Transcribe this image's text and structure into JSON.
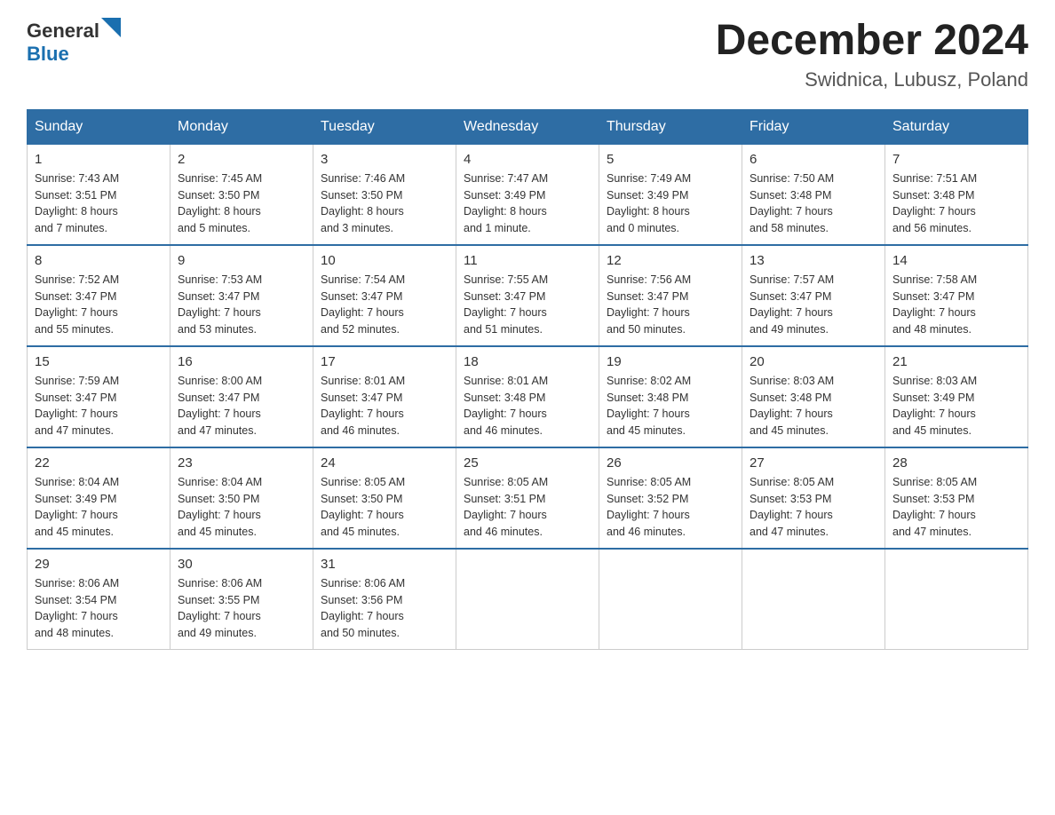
{
  "header": {
    "logo": {
      "text_general": "General",
      "text_blue": "Blue"
    },
    "month_title": "December 2024",
    "location": "Swidnica, Lubusz, Poland"
  },
  "calendar": {
    "days_of_week": [
      "Sunday",
      "Monday",
      "Tuesday",
      "Wednesday",
      "Thursday",
      "Friday",
      "Saturday"
    ],
    "weeks": [
      [
        {
          "day": "1",
          "sunrise": "Sunrise: 7:43 AM",
          "sunset": "Sunset: 3:51 PM",
          "daylight": "Daylight: 8 hours",
          "daylight2": "and 7 minutes."
        },
        {
          "day": "2",
          "sunrise": "Sunrise: 7:45 AM",
          "sunset": "Sunset: 3:50 PM",
          "daylight": "Daylight: 8 hours",
          "daylight2": "and 5 minutes."
        },
        {
          "day": "3",
          "sunrise": "Sunrise: 7:46 AM",
          "sunset": "Sunset: 3:50 PM",
          "daylight": "Daylight: 8 hours",
          "daylight2": "and 3 minutes."
        },
        {
          "day": "4",
          "sunrise": "Sunrise: 7:47 AM",
          "sunset": "Sunset: 3:49 PM",
          "daylight": "Daylight: 8 hours",
          "daylight2": "and 1 minute."
        },
        {
          "day": "5",
          "sunrise": "Sunrise: 7:49 AM",
          "sunset": "Sunset: 3:49 PM",
          "daylight": "Daylight: 8 hours",
          "daylight2": "and 0 minutes."
        },
        {
          "day": "6",
          "sunrise": "Sunrise: 7:50 AM",
          "sunset": "Sunset: 3:48 PM",
          "daylight": "Daylight: 7 hours",
          "daylight2": "and 58 minutes."
        },
        {
          "day": "7",
          "sunrise": "Sunrise: 7:51 AM",
          "sunset": "Sunset: 3:48 PM",
          "daylight": "Daylight: 7 hours",
          "daylight2": "and 56 minutes."
        }
      ],
      [
        {
          "day": "8",
          "sunrise": "Sunrise: 7:52 AM",
          "sunset": "Sunset: 3:47 PM",
          "daylight": "Daylight: 7 hours",
          "daylight2": "and 55 minutes."
        },
        {
          "day": "9",
          "sunrise": "Sunrise: 7:53 AM",
          "sunset": "Sunset: 3:47 PM",
          "daylight": "Daylight: 7 hours",
          "daylight2": "and 53 minutes."
        },
        {
          "day": "10",
          "sunrise": "Sunrise: 7:54 AM",
          "sunset": "Sunset: 3:47 PM",
          "daylight": "Daylight: 7 hours",
          "daylight2": "and 52 minutes."
        },
        {
          "day": "11",
          "sunrise": "Sunrise: 7:55 AM",
          "sunset": "Sunset: 3:47 PM",
          "daylight": "Daylight: 7 hours",
          "daylight2": "and 51 minutes."
        },
        {
          "day": "12",
          "sunrise": "Sunrise: 7:56 AM",
          "sunset": "Sunset: 3:47 PM",
          "daylight": "Daylight: 7 hours",
          "daylight2": "and 50 minutes."
        },
        {
          "day": "13",
          "sunrise": "Sunrise: 7:57 AM",
          "sunset": "Sunset: 3:47 PM",
          "daylight": "Daylight: 7 hours",
          "daylight2": "and 49 minutes."
        },
        {
          "day": "14",
          "sunrise": "Sunrise: 7:58 AM",
          "sunset": "Sunset: 3:47 PM",
          "daylight": "Daylight: 7 hours",
          "daylight2": "and 48 minutes."
        }
      ],
      [
        {
          "day": "15",
          "sunrise": "Sunrise: 7:59 AM",
          "sunset": "Sunset: 3:47 PM",
          "daylight": "Daylight: 7 hours",
          "daylight2": "and 47 minutes."
        },
        {
          "day": "16",
          "sunrise": "Sunrise: 8:00 AM",
          "sunset": "Sunset: 3:47 PM",
          "daylight": "Daylight: 7 hours",
          "daylight2": "and 47 minutes."
        },
        {
          "day": "17",
          "sunrise": "Sunrise: 8:01 AM",
          "sunset": "Sunset: 3:47 PM",
          "daylight": "Daylight: 7 hours",
          "daylight2": "and 46 minutes."
        },
        {
          "day": "18",
          "sunrise": "Sunrise: 8:01 AM",
          "sunset": "Sunset: 3:48 PM",
          "daylight": "Daylight: 7 hours",
          "daylight2": "and 46 minutes."
        },
        {
          "day": "19",
          "sunrise": "Sunrise: 8:02 AM",
          "sunset": "Sunset: 3:48 PM",
          "daylight": "Daylight: 7 hours",
          "daylight2": "and 45 minutes."
        },
        {
          "day": "20",
          "sunrise": "Sunrise: 8:03 AM",
          "sunset": "Sunset: 3:48 PM",
          "daylight": "Daylight: 7 hours",
          "daylight2": "and 45 minutes."
        },
        {
          "day": "21",
          "sunrise": "Sunrise: 8:03 AM",
          "sunset": "Sunset: 3:49 PM",
          "daylight": "Daylight: 7 hours",
          "daylight2": "and 45 minutes."
        }
      ],
      [
        {
          "day": "22",
          "sunrise": "Sunrise: 8:04 AM",
          "sunset": "Sunset: 3:49 PM",
          "daylight": "Daylight: 7 hours",
          "daylight2": "and 45 minutes."
        },
        {
          "day": "23",
          "sunrise": "Sunrise: 8:04 AM",
          "sunset": "Sunset: 3:50 PM",
          "daylight": "Daylight: 7 hours",
          "daylight2": "and 45 minutes."
        },
        {
          "day": "24",
          "sunrise": "Sunrise: 8:05 AM",
          "sunset": "Sunset: 3:50 PM",
          "daylight": "Daylight: 7 hours",
          "daylight2": "and 45 minutes."
        },
        {
          "day": "25",
          "sunrise": "Sunrise: 8:05 AM",
          "sunset": "Sunset: 3:51 PM",
          "daylight": "Daylight: 7 hours",
          "daylight2": "and 46 minutes."
        },
        {
          "day": "26",
          "sunrise": "Sunrise: 8:05 AM",
          "sunset": "Sunset: 3:52 PM",
          "daylight": "Daylight: 7 hours",
          "daylight2": "and 46 minutes."
        },
        {
          "day": "27",
          "sunrise": "Sunrise: 8:05 AM",
          "sunset": "Sunset: 3:53 PM",
          "daylight": "Daylight: 7 hours",
          "daylight2": "and 47 minutes."
        },
        {
          "day": "28",
          "sunrise": "Sunrise: 8:05 AM",
          "sunset": "Sunset: 3:53 PM",
          "daylight": "Daylight: 7 hours",
          "daylight2": "and 47 minutes."
        }
      ],
      [
        {
          "day": "29",
          "sunrise": "Sunrise: 8:06 AM",
          "sunset": "Sunset: 3:54 PM",
          "daylight": "Daylight: 7 hours",
          "daylight2": "and 48 minutes."
        },
        {
          "day": "30",
          "sunrise": "Sunrise: 8:06 AM",
          "sunset": "Sunset: 3:55 PM",
          "daylight": "Daylight: 7 hours",
          "daylight2": "and 49 minutes."
        },
        {
          "day": "31",
          "sunrise": "Sunrise: 8:06 AM",
          "sunset": "Sunset: 3:56 PM",
          "daylight": "Daylight: 7 hours",
          "daylight2": "and 50 minutes."
        },
        null,
        null,
        null,
        null
      ]
    ]
  }
}
